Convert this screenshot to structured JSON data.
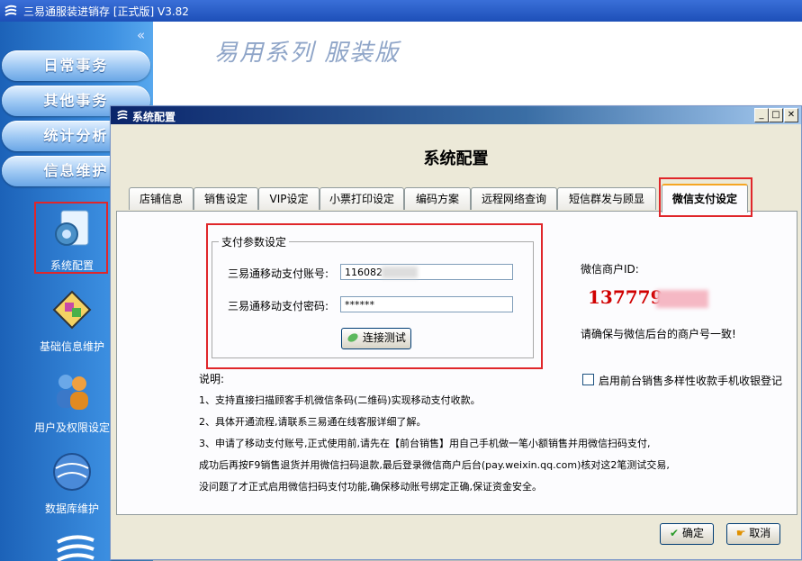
{
  "app": {
    "title": "三易通服装进销存 [正式版] V3.82",
    "header_subtitle": "易用系列 服装版"
  },
  "sidebar": {
    "collapse_glyph": "«",
    "nav_buttons": [
      "日常事务",
      "其他事务",
      "统计分析",
      "信息维护"
    ],
    "icons": [
      {
        "label": "系统配置",
        "icon": "system-config-icon"
      },
      {
        "label": "基础信息维护",
        "icon": "basic-info-icon"
      },
      {
        "label": "用户及权限设定",
        "icon": "user-permission-icon"
      },
      {
        "label": "数据库维护",
        "icon": "database-icon"
      }
    ]
  },
  "dialog": {
    "title": "系统配置",
    "heading": "系统配置",
    "tabs": [
      "店铺信息",
      "销售设定",
      "VIP设定",
      "小票打印设定",
      "编码方案",
      "远程网络查询",
      "短信群发与顾显",
      "微信支付设定"
    ],
    "active_tab": "微信支付设定",
    "group": {
      "legend": "支付参数设定",
      "account_label": "三易通移动支付账号:",
      "account_value": "116082",
      "password_label": "三易通移动支付密码:",
      "password_value": "******",
      "test_button": "连接测试"
    },
    "merchant": {
      "label": "微信商户ID:",
      "value": "137779",
      "note": "请确保与微信后台的商户号一致!"
    },
    "checkbox_label": "启用前台销售多样性收款手机收银登记",
    "notes": [
      "说明:",
      "1、支持直接扫描顾客手机微信条码(二维码)实现移动支付收款。",
      "2、具体开通流程,请联系三易通在线客服详细了解。",
      "3、申请了移动支付账号,正式使用前,请先在【前台销售】用自己手机做一笔小额销售并用微信扫码支付,",
      "成功后再按F9销售退货并用微信扫码退款,最后登录微信商户后台(pay.weixin.qq.com)核对这2笔测试交易,",
      "没问题了才正式启用微信扫码支付功能,确保移动账号绑定正确,保证资金安全。"
    ],
    "ok_button": "确定",
    "cancel_button": "取消"
  },
  "colors": {
    "accent": "#1d4fb8",
    "highlight": "#e0262a",
    "merchant_id": "#d00000"
  }
}
